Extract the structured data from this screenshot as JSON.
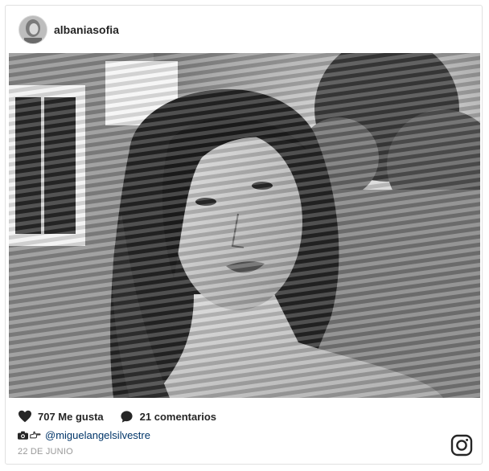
{
  "post": {
    "username": "albaniasofia",
    "likes": "707 Me gusta",
    "comments": "21 comentarios",
    "credit_handle": "@miguelangelsilvestre",
    "date": "22 DE JUNIO"
  },
  "icons": {
    "like": "heart-icon",
    "comment": "comment-bubble-icon",
    "camera": "camera-icon",
    "pointer": "pointing-hand-icon",
    "platform": "instagram-logo-icon"
  },
  "colors": {
    "text": "#262626",
    "link": "#003569",
    "muted": "#999999",
    "border": "#e0e0e0"
  }
}
